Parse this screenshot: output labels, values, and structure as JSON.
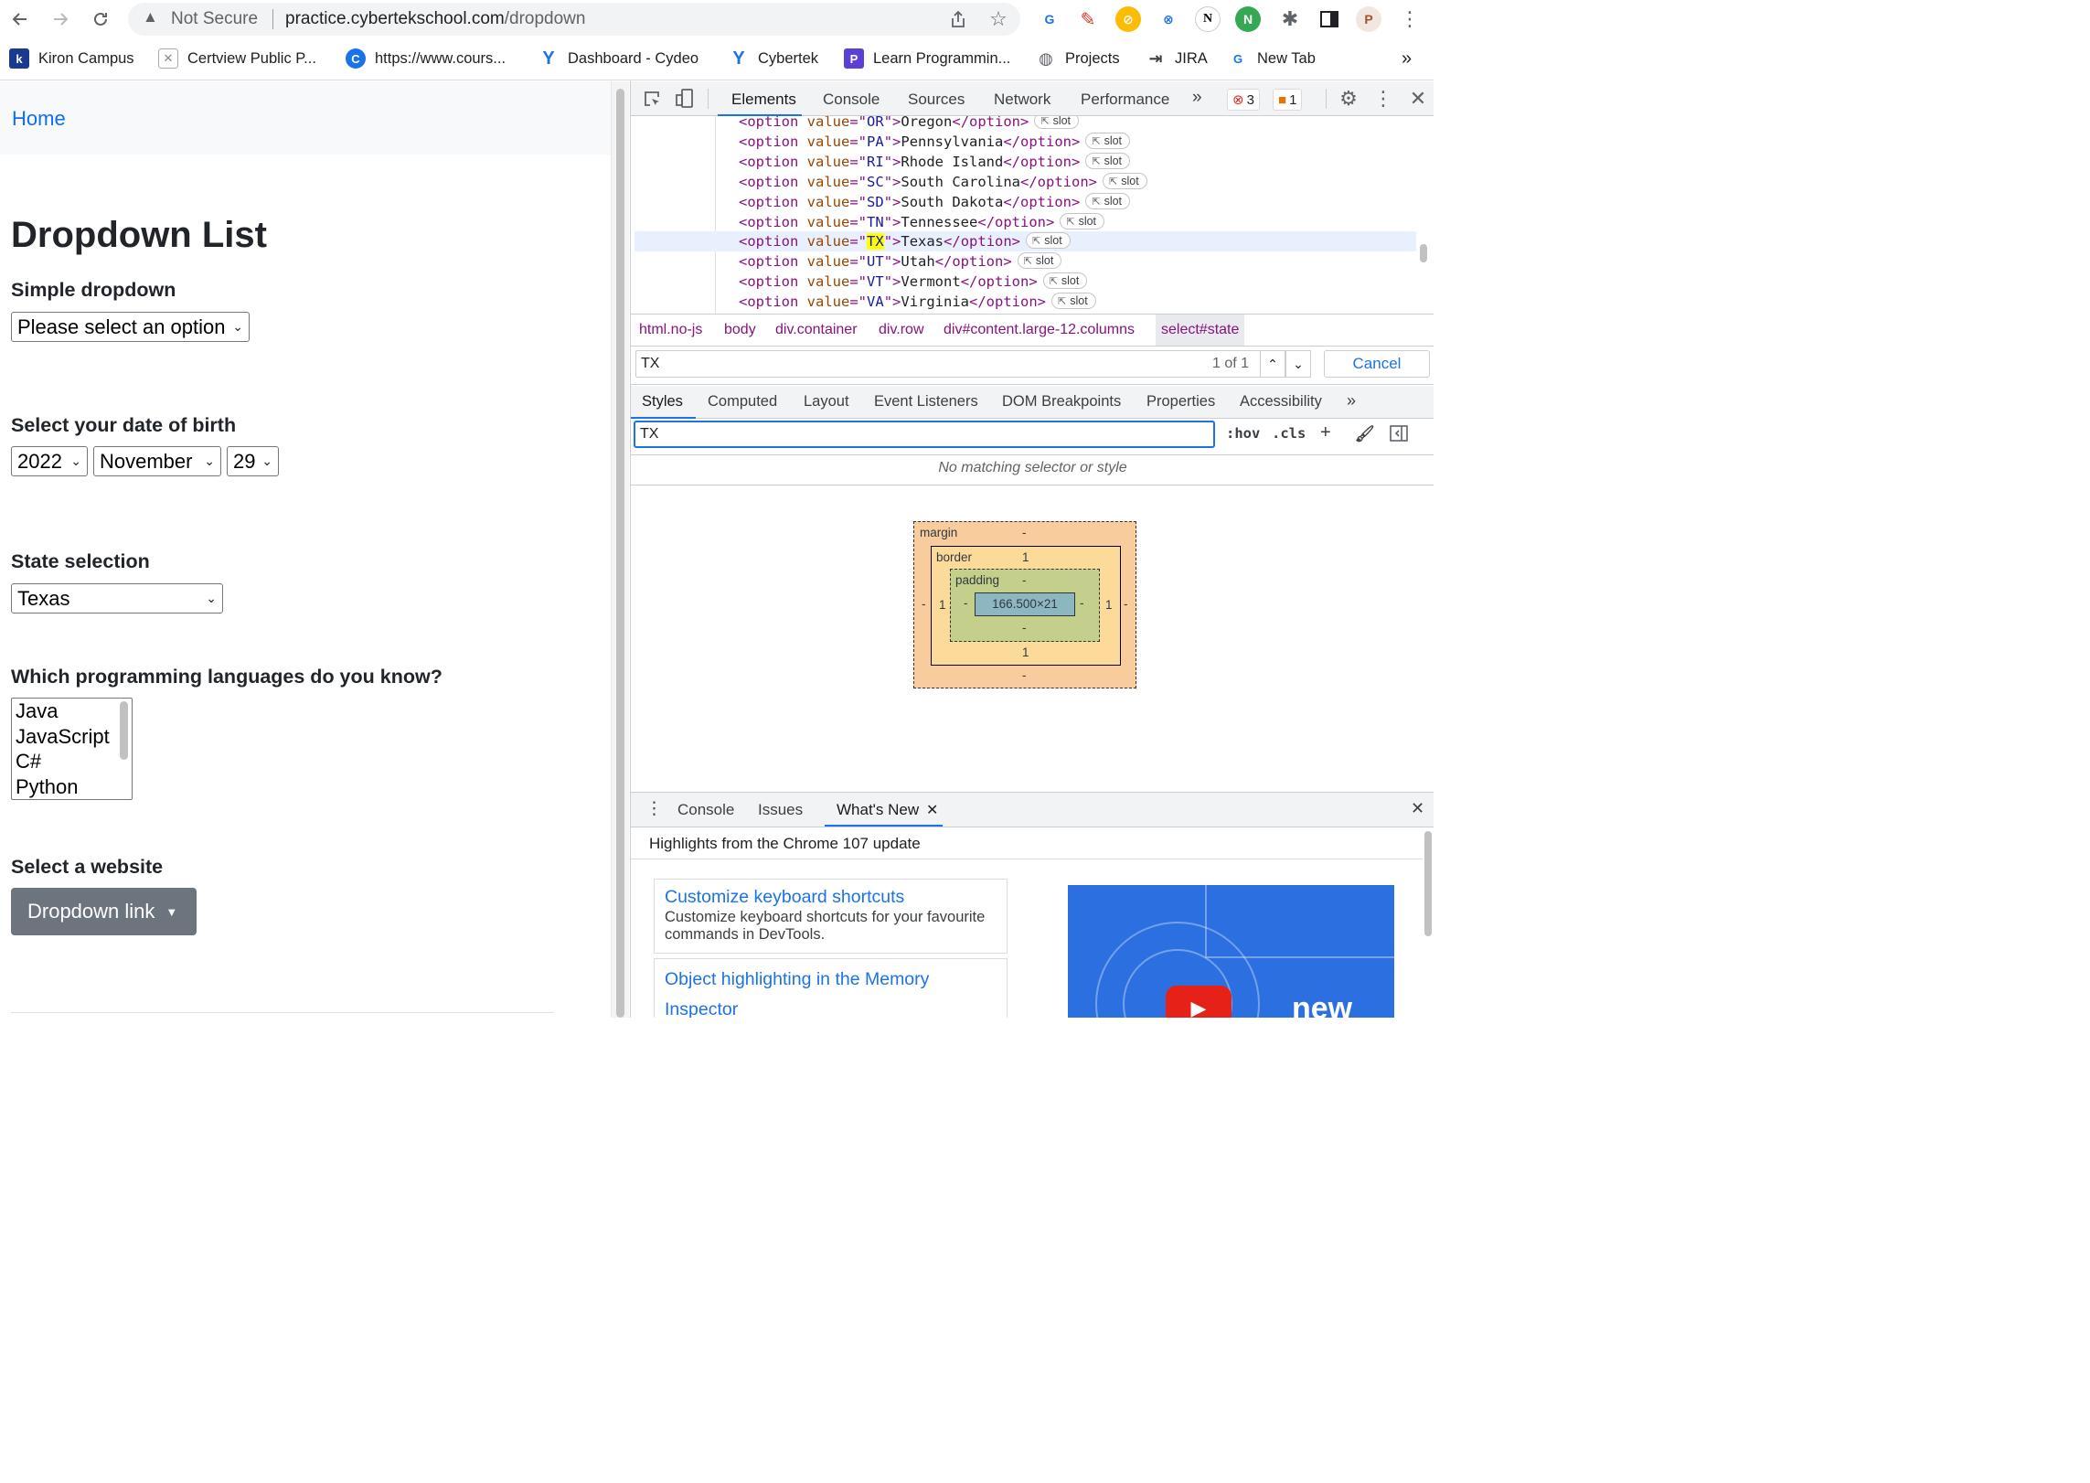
{
  "browser": {
    "omnibox": {
      "security": "Not Secure",
      "host": "practice.cybertekschool.com",
      "path": "/dropdown"
    },
    "bookmarks": [
      {
        "label": "Kiron Campus",
        "icon": "kiron-favicon"
      },
      {
        "label": "Certview Public P...",
        "icon": "certview-favicon"
      },
      {
        "label": "https://www.cours...",
        "icon": "coursera-favicon"
      },
      {
        "label": "Dashboard - Cydeo",
        "icon": "cydeo-favicon"
      },
      {
        "label": "Cybertek",
        "icon": "cybertek-favicon"
      },
      {
        "label": "Learn Programmin...",
        "icon": "learn-favicon"
      },
      {
        "label": "Projects",
        "icon": "globe-icon"
      },
      {
        "label": "JIRA",
        "icon": "jira-icon"
      },
      {
        "label": "New Tab",
        "icon": "translate-favicon"
      }
    ],
    "bookmarks_more": "»"
  },
  "page": {
    "home_link": "Home",
    "title": "Dropdown List",
    "simple_label": "Simple dropdown",
    "simple_value": "Please select an option",
    "dob_label": "Select your date of birth",
    "dob_year": "2022",
    "dob_month": "November",
    "dob_day": "29",
    "state_label": "State selection",
    "state_value": "Texas",
    "languages_label": "Which programming languages do you know?",
    "languages": [
      "Java",
      "JavaScript",
      "C#",
      "Python"
    ],
    "website_label": "Select a website",
    "dropdown_button": "Dropdown link"
  },
  "devtools": {
    "tabs": [
      "Elements",
      "Console",
      "Sources",
      "Network",
      "Performance"
    ],
    "tabs_more": "»",
    "error_count": "3",
    "warning_count": "1",
    "dom_lines": [
      {
        "value": "OR",
        "text": "Oregon"
      },
      {
        "value": "PA",
        "text": "Pennsylvania"
      },
      {
        "value": "RI",
        "text": "Rhode Island"
      },
      {
        "value": "SC",
        "text": "South Carolina"
      },
      {
        "value": "SD",
        "text": "South Dakota"
      },
      {
        "value": "TN",
        "text": "Tennessee"
      },
      {
        "value": "TX",
        "text": "Texas"
      },
      {
        "value": "UT",
        "text": "Utah"
      },
      {
        "value": "VT",
        "text": "Vermont"
      },
      {
        "value": "VA",
        "text": "Virginia"
      }
    ],
    "slot_label": "slot",
    "breadcrumb": [
      "html.no-js",
      "body",
      "div.container",
      "div.row",
      "div#content.large-12.columns",
      "select#state"
    ],
    "find": {
      "query": "TX",
      "count": "1 of 1",
      "cancel": "Cancel"
    },
    "sub_tabs": [
      "Styles",
      "Computed",
      "Layout",
      "Event Listeners",
      "DOM Breakpoints",
      "Properties",
      "Accessibility"
    ],
    "sub_tabs_more": "»",
    "filter_value": "TX",
    "filter_hov": ":hov",
    "filter_cls": ".cls",
    "no_match": "No matching selector or style",
    "box_model": {
      "margin_label": "margin",
      "margin_top": "-",
      "margin_bottom": "-",
      "margin_left": "-",
      "margin_right": "-",
      "border_label": "border",
      "border_top": "1",
      "border_bottom": "1",
      "border_left": "1",
      "border_right": "1",
      "padding_label": "padding",
      "padding_top": "-",
      "padding_bottom": "-",
      "padding_left": "-",
      "padding_right": "-",
      "content": "166.500×21"
    },
    "drawer": {
      "tabs": [
        "Console",
        "Issues",
        "What's New"
      ],
      "highlights": "Highlights from the Chrome 107 update",
      "cards": [
        {
          "title": "Customize keyboard shortcuts",
          "desc": "Customize keyboard shortcuts for your favourite commands in DevTools."
        },
        {
          "title": "Object highlighting in the Memory Inspector",
          "desc": ""
        }
      ],
      "video_text": "new"
    }
  }
}
